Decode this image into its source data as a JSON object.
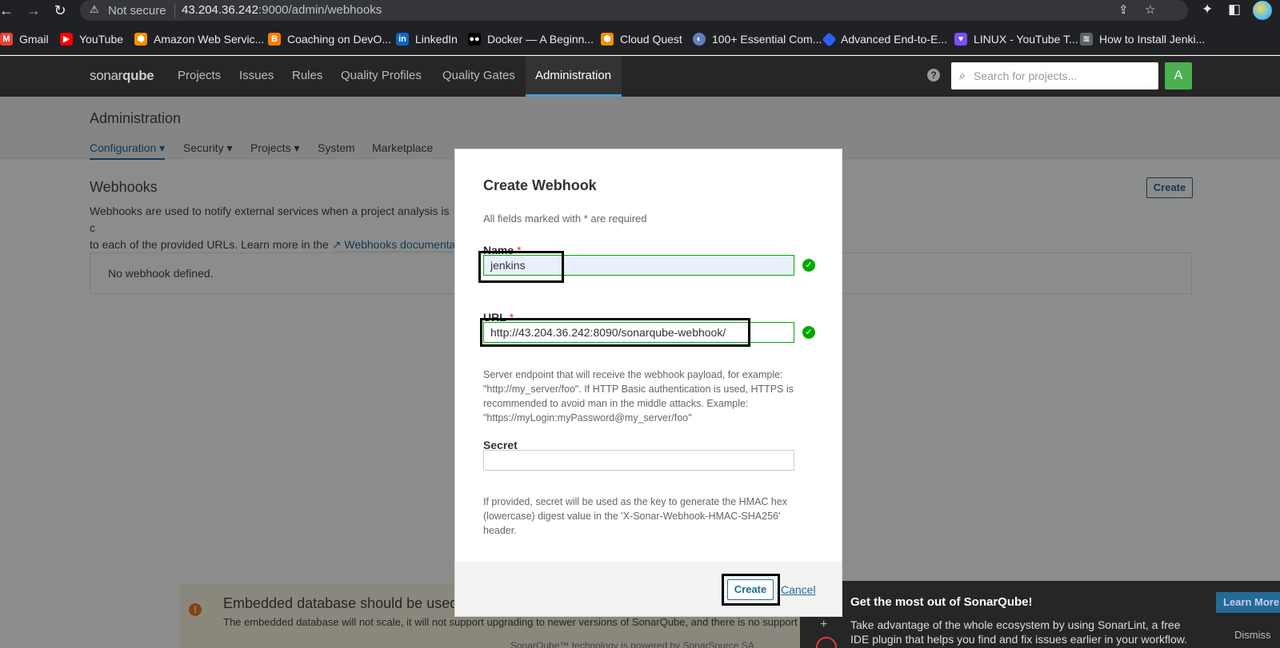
{
  "browser": {
    "security_label": "Not secure",
    "url_host": "43.204.36.242",
    "url_path": ":9000/admin/webhooks"
  },
  "bookmarks": [
    {
      "label": "Gmail",
      "icon": "gmail-icon",
      "color": "#ea4335"
    },
    {
      "label": "YouTube",
      "icon": "youtube-icon",
      "color": "#ff0000"
    },
    {
      "label": "Amazon Web Servic...",
      "icon": "aws-icon",
      "color": "#f29100"
    },
    {
      "label": "Coaching on DevO...",
      "icon": "blogger-icon",
      "color": "#f57d00"
    },
    {
      "label": "LinkedIn",
      "icon": "linkedin-icon",
      "color": "#0a66c2"
    },
    {
      "label": "Docker — A Beginn...",
      "icon": "medium-icon",
      "color": "#000000"
    },
    {
      "label": "Cloud Quest",
      "icon": "aws-icon",
      "color": "#f29100"
    },
    {
      "label": "100+ Essential Com...",
      "icon": "site-icon",
      "color": "#5f7fbf"
    },
    {
      "label": "Advanced End-to-E...",
      "icon": "diamond-icon",
      "color": "#2962ff"
    },
    {
      "label": "LINUX - YouTube T...",
      "icon": "heart-icon",
      "color": "#7c4dff"
    },
    {
      "label": "How to Install Jenki...",
      "icon": "bookmark-icon",
      "color": "#5f6368"
    }
  ],
  "sonar_nav": {
    "logo_a": "sonar",
    "logo_b": "qube",
    "items": [
      "Projects",
      "Issues",
      "Rules",
      "Quality Profiles",
      "Quality Gates",
      "Administration"
    ],
    "search_placeholder": "Search for projects...",
    "avatar_letter": "A"
  },
  "admin": {
    "title": "Administration",
    "tabs": [
      "Configuration",
      "Security",
      "Projects",
      "System",
      "Marketplace"
    ]
  },
  "webhooks_page": {
    "title": "Webhooks",
    "desc_line1": "Webhooks are used to notify external services when a project analysis is c",
    "desc_line2_prefix": "to each of the provided URLs. Learn more in the",
    "desc_link": "Webhooks documenta",
    "create_label": "Create",
    "empty_text": "No webhook defined."
  },
  "modal": {
    "title": "Create Webhook",
    "required_note": "All fields marked with * are required",
    "name_label": "Name",
    "name_value": "jenkins",
    "url_label": "URL",
    "url_value": "http://43.204.36.242:8090/sonarqube-webhook/",
    "url_help": "Server endpoint that will receive the webhook payload, for example: \"http://my_server/foo\". If HTTP Basic authentication is used, HTTPS is recommended to avoid man in the middle attacks. Example: \"https://myLogin:myPassword@my_server/foo\"",
    "secret_label": "Secret",
    "secret_value": "",
    "secret_help": "If provided, secret will be used as the key to generate the HMAC hex (lowercase) digest value in the 'X-Sonar-Webhook-HMAC-SHA256' header.",
    "create_label": "Create",
    "cancel_label": "Cancel",
    "required_star": "*"
  },
  "warning": {
    "title": "Embedded database should be used f",
    "text": "The embedded database will not scale, it will not support upgrading to newer versions of SonarQube, and there is no support f"
  },
  "footer_text": "SonarQube™ technology is powered by SonarSource SA",
  "promo": {
    "title": "Get the most out of SonarQube!",
    "text": "Take advantage of the whole ecosystem by using SonarLint, a free IDE plugin that helps you find and fix issues earlier in your workflow.",
    "learn_more": "Learn More",
    "dismiss": "Dismiss"
  },
  "colors": {
    "accent": "#236a97",
    "valid": "#00aa00",
    "nav_bg": "#262626"
  }
}
